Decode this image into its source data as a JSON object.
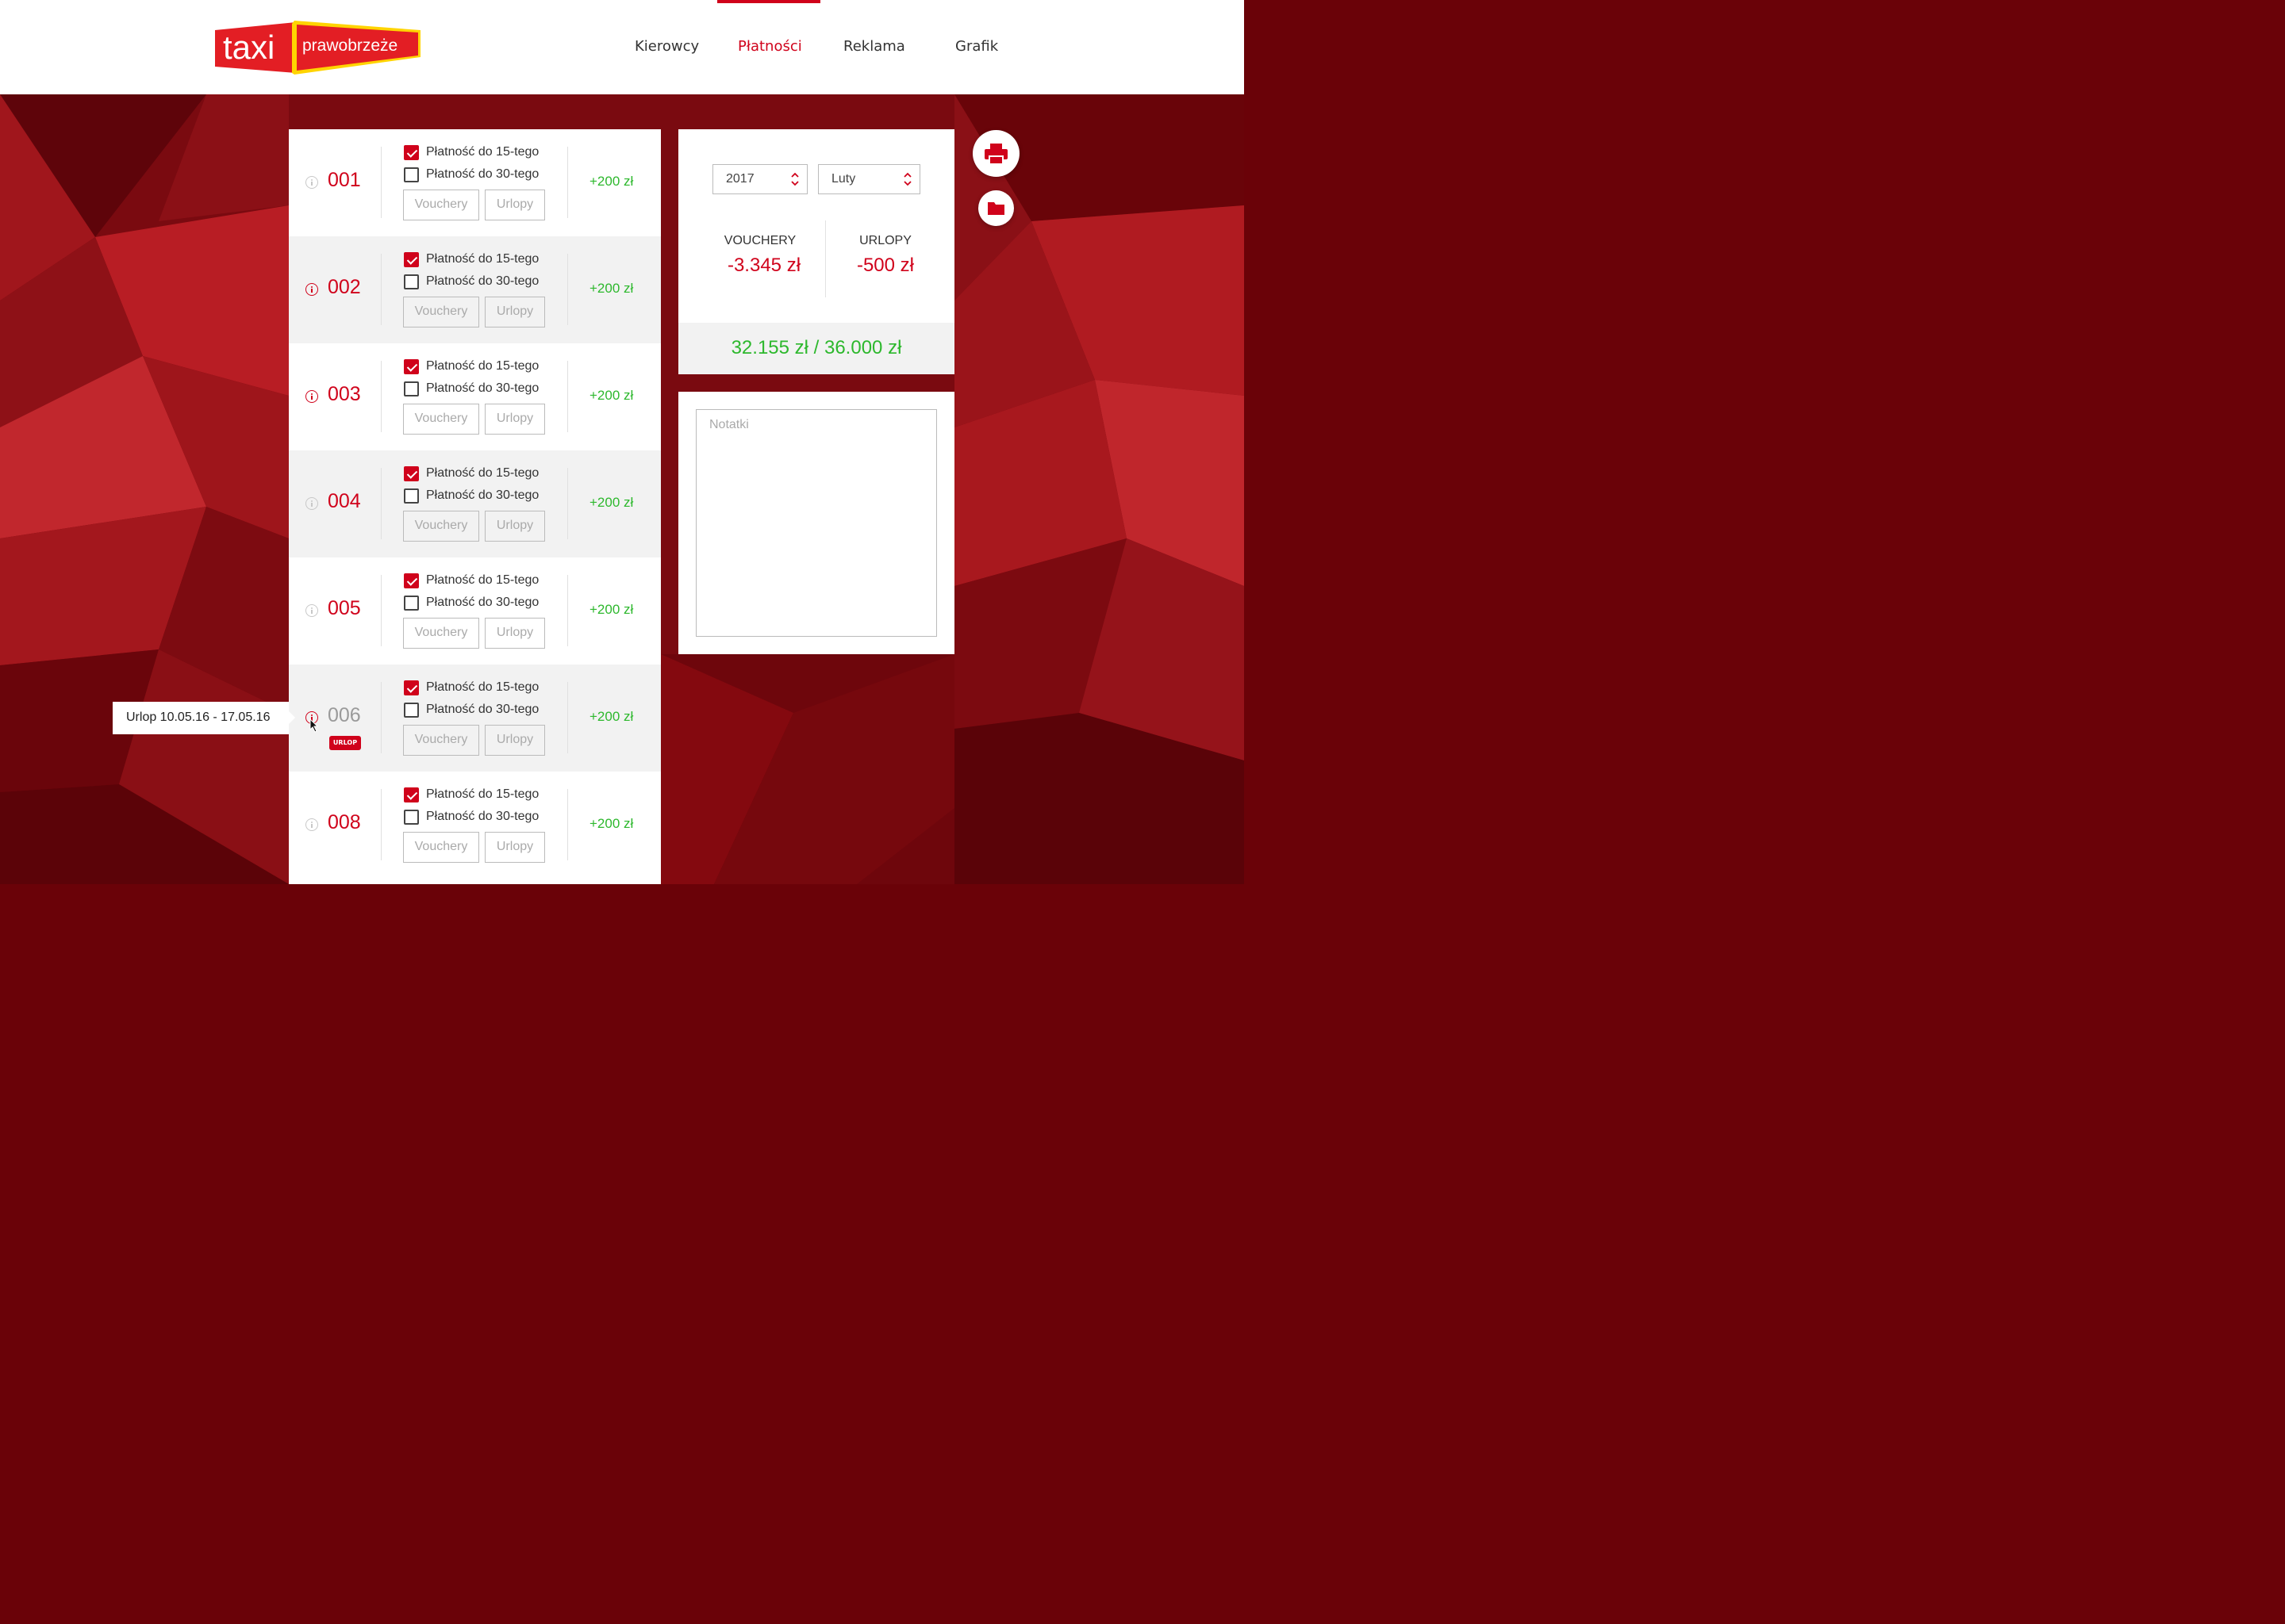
{
  "brand": {
    "logo_word": "taxi",
    "logo_sub": "prawobrzeże"
  },
  "nav": {
    "items": [
      {
        "label": "Kierowcy"
      },
      {
        "label": "Płatności"
      },
      {
        "label": "Reklama"
      },
      {
        "label": "Grafik"
      }
    ],
    "active": "Płatności"
  },
  "drivers": {
    "option_15": "Płatność do 15-tego",
    "option_30": "Płatność do 30-tego",
    "vouchers_label": "Vouchery",
    "leave_label": "Urlopy",
    "rows": [
      {
        "number": "001",
        "amount": "+200 zł",
        "paid_15": true,
        "paid_30": false
      },
      {
        "number": "002",
        "amount": "+200 zł",
        "paid_15": true,
        "paid_30": false
      },
      {
        "number": "003",
        "amount": "+200 zł",
        "paid_15": true,
        "paid_30": false
      },
      {
        "number": "004",
        "amount": "+200 zł",
        "paid_15": true,
        "paid_30": false
      },
      {
        "number": "005",
        "amount": "+200 zł",
        "paid_15": true,
        "paid_30": false
      },
      {
        "number": "006",
        "amount": "+200 zł",
        "paid_15": true,
        "paid_30": false,
        "badge": "URLOP"
      },
      {
        "number": "008",
        "amount": "+200 zł",
        "paid_15": true,
        "paid_30": false
      }
    ]
  },
  "tooltip": {
    "text": "Urlop 10.05.16 - 17.05.16"
  },
  "summary": {
    "year": "2017",
    "month": "Luty",
    "vouchers_label": "VOUCHERY",
    "vouchers_value": "-3.345 zł",
    "leave_label": "URLOPY",
    "leave_value": "-500 zł",
    "total": "32.155 zł / 36.000 zł"
  },
  "notes": {
    "placeholder": "Notatki"
  },
  "icons": {
    "print": "printer-icon",
    "folder": "folder-icon",
    "info": "info-icon"
  },
  "colors": {
    "accent": "#d0021b",
    "positive": "#2db82d",
    "background": "#6a0208"
  }
}
